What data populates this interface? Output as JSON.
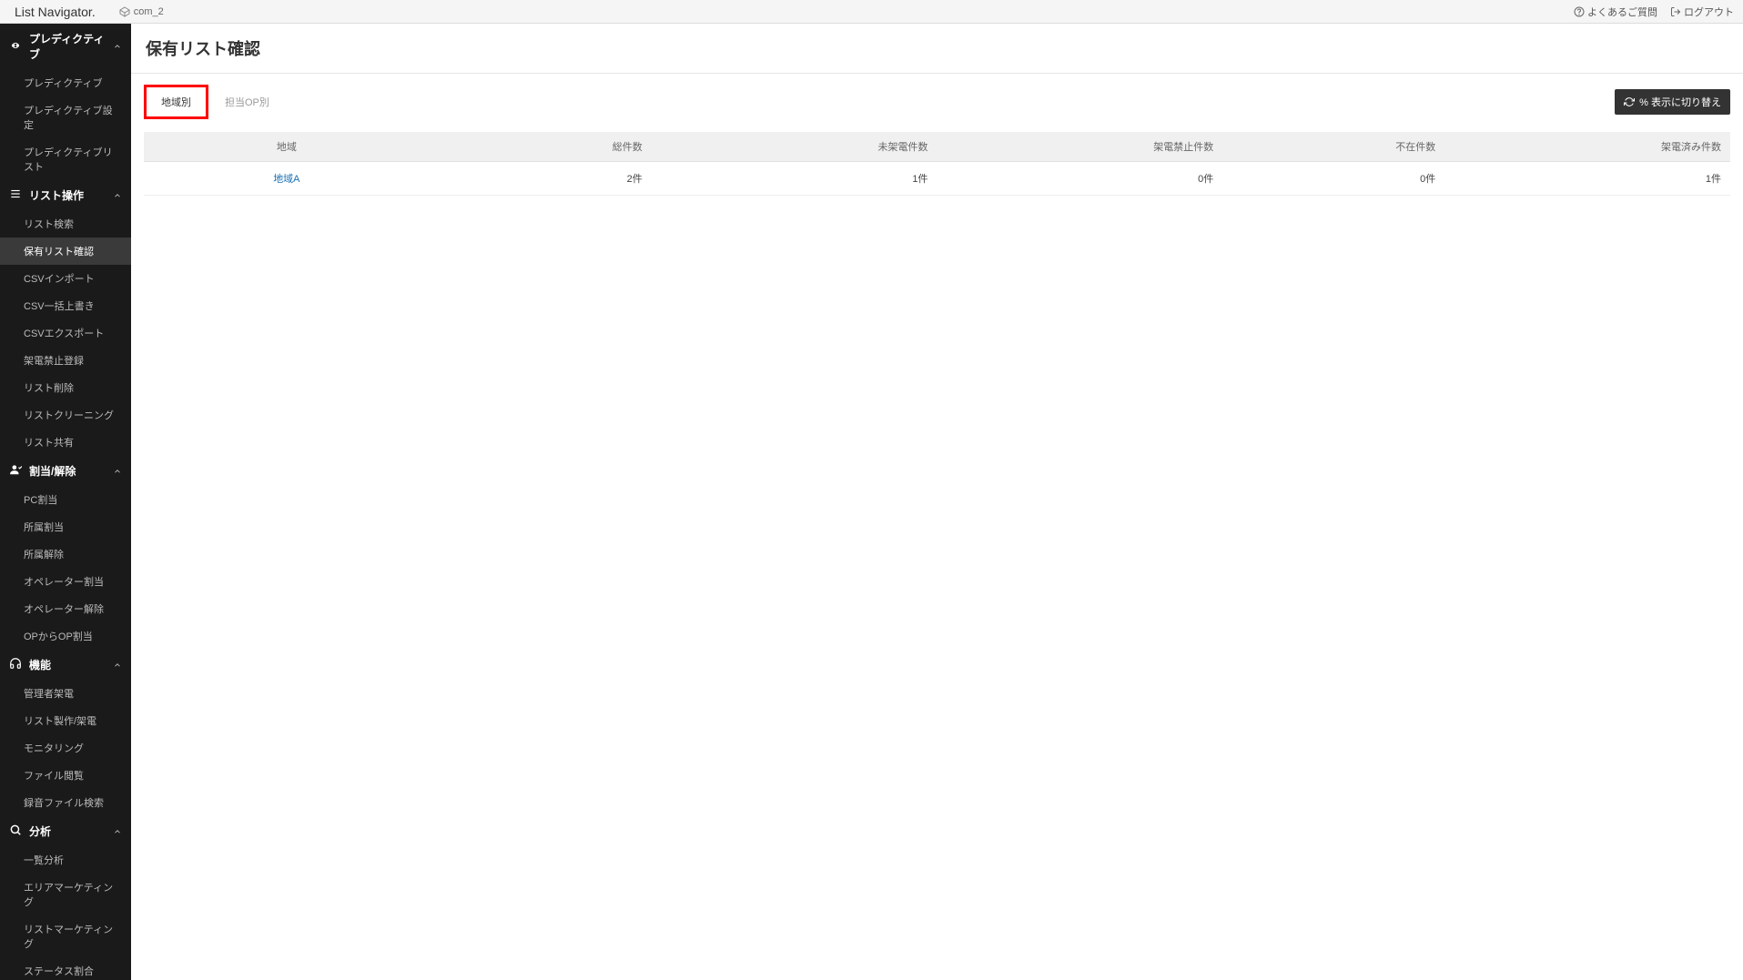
{
  "topbar": {
    "logo": "List Navigator.",
    "company": "com_2",
    "faq": "よくあるご質問",
    "logout": "ログアウト"
  },
  "sidebar": {
    "groups": [
      {
        "label": "プレディクティブ",
        "items": [
          {
            "label": "プレディクティブ",
            "active": false
          },
          {
            "label": "プレディクティブ設定",
            "active": false
          },
          {
            "label": "プレディクティブリスト",
            "active": false
          }
        ]
      },
      {
        "label": "リスト操作",
        "items": [
          {
            "label": "リスト検索",
            "active": false
          },
          {
            "label": "保有リスト確認",
            "active": true
          },
          {
            "label": "CSVインポート",
            "active": false
          },
          {
            "label": "CSV一括上書き",
            "active": false
          },
          {
            "label": "CSVエクスポート",
            "active": false
          },
          {
            "label": "架電禁止登録",
            "active": false
          },
          {
            "label": "リスト削除",
            "active": false
          },
          {
            "label": "リストクリーニング",
            "active": false
          },
          {
            "label": "リスト共有",
            "active": false
          }
        ]
      },
      {
        "label": "割当/解除",
        "items": [
          {
            "label": "PC割当",
            "active": false
          },
          {
            "label": "所属割当",
            "active": false
          },
          {
            "label": "所属解除",
            "active": false
          },
          {
            "label": "オペレーター割当",
            "active": false
          },
          {
            "label": "オペレーター解除",
            "active": false
          },
          {
            "label": "OPからOP割当",
            "active": false
          }
        ]
      },
      {
        "label": "機能",
        "items": [
          {
            "label": "管理者架電",
            "active": false
          },
          {
            "label": "リスト製作/架電",
            "active": false
          },
          {
            "label": "モニタリング",
            "active": false
          },
          {
            "label": "ファイル閲覧",
            "active": false
          },
          {
            "label": "録音ファイル検索",
            "active": false
          }
        ]
      },
      {
        "label": "分析",
        "items": [
          {
            "label": "一覧分析",
            "active": false
          },
          {
            "label": "エリアマーケティング",
            "active": false
          },
          {
            "label": "リストマーケティング",
            "active": false
          },
          {
            "label": "ステータス割合",
            "active": false
          }
        ]
      }
    ]
  },
  "page": {
    "title": "保有リスト確認",
    "tabs": [
      {
        "label": "地域別",
        "active": true
      },
      {
        "label": "担当OP別",
        "active": false
      }
    ],
    "switch_button": "% 表示に切り替え",
    "table": {
      "headers": [
        "地域",
        "総件数",
        "未架電件数",
        "架電禁止件数",
        "不在件数",
        "架電済み件数"
      ],
      "rows": [
        {
          "region": "地域A",
          "total": "2件",
          "notcalled": "1件",
          "banned": "0件",
          "absent": "0件",
          "called": "1件"
        }
      ]
    }
  }
}
